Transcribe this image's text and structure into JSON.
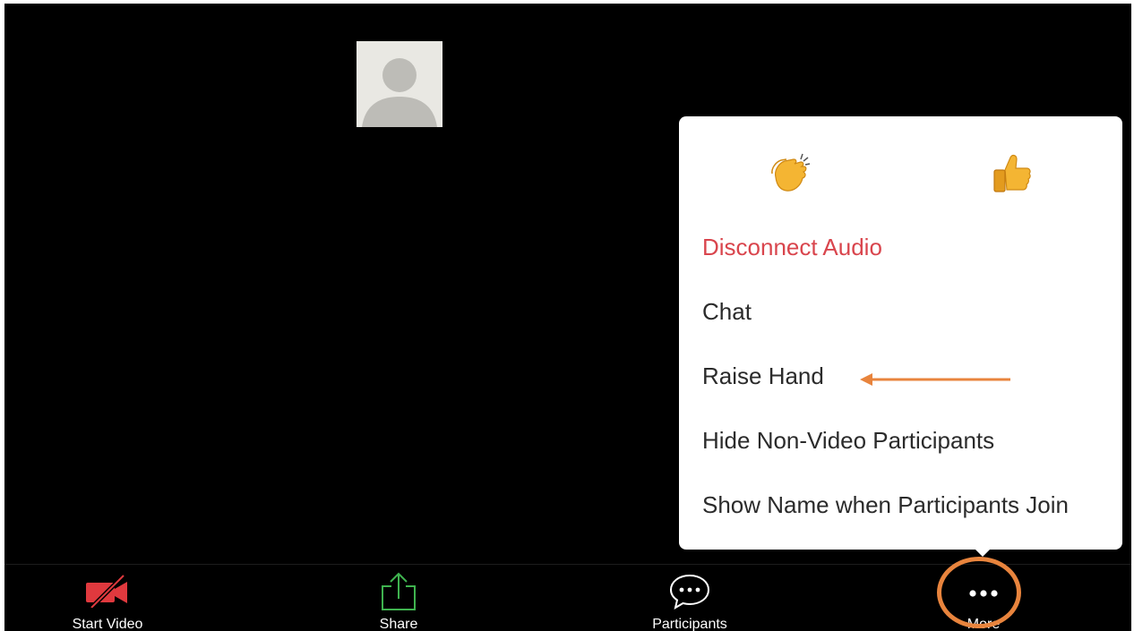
{
  "avatar": {
    "icon": "default-user-avatar-icon"
  },
  "menu": {
    "reactions": [
      {
        "icon": "clapping-hands-icon",
        "glyph": "👏"
      },
      {
        "icon": "thumbs-up-icon",
        "glyph": "👍"
      }
    ],
    "items": [
      {
        "label": "Disconnect Audio",
        "color": "#d9454d"
      },
      {
        "label": "Chat"
      },
      {
        "label": "Raise Hand"
      },
      {
        "label": "Hide Non-Video Participants"
      },
      {
        "label": "Show Name when Participants Join"
      }
    ]
  },
  "annotation": {
    "arrow_icon": "left-arrow-icon",
    "ring_icon": "highlight-circle-icon",
    "color": "#e8843d"
  },
  "toolbar": {
    "start_video": {
      "label": "Start Video",
      "icon": "video-off-icon",
      "color": "#e0393e"
    },
    "share": {
      "label": "Share",
      "icon": "share-upload-icon",
      "color": "#3fb34f"
    },
    "participants": {
      "label": "Participants",
      "icon": "chat-bubble-icon"
    },
    "more": {
      "label": "More",
      "icon": "more-dots-icon"
    }
  },
  "colors": {
    "background": "#000000",
    "menu_background": "#ffffff",
    "menu_text": "#2b2b2b"
  }
}
